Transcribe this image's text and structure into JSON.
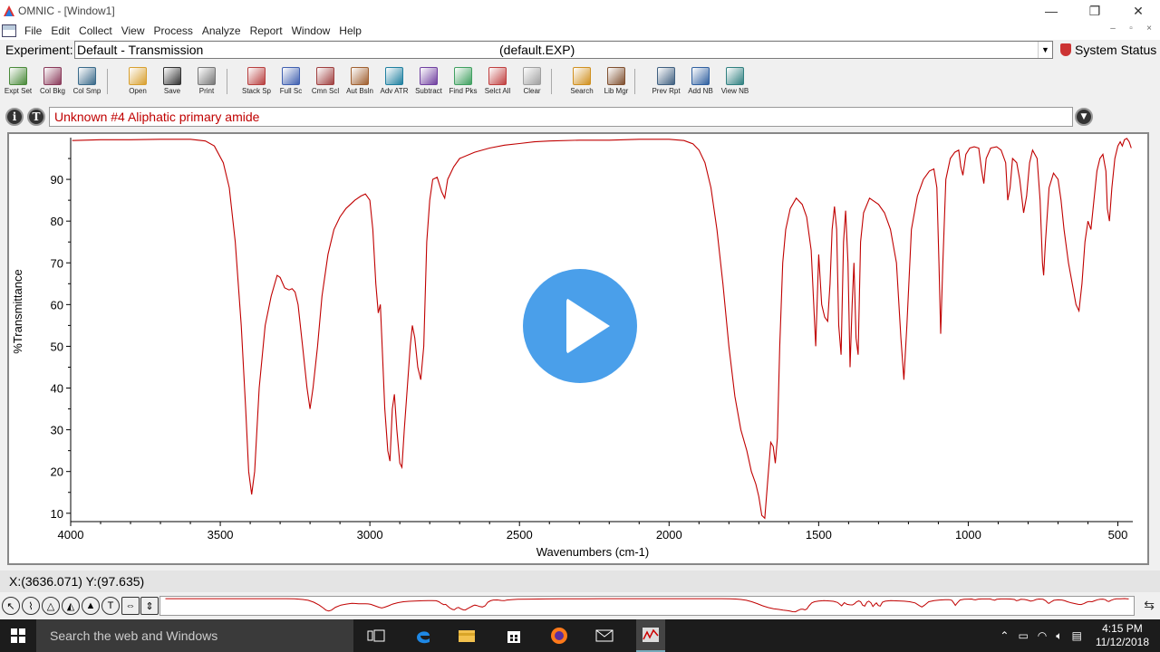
{
  "window": {
    "title": "OMNIC - [Window1]",
    "controls": [
      "—",
      "❐",
      "✕"
    ]
  },
  "menu": {
    "items": [
      "File",
      "Edit",
      "Collect",
      "View",
      "Process",
      "Analyze",
      "Report",
      "Window",
      "Help"
    ]
  },
  "experiment": {
    "label": "Experiment:",
    "value": "Default - Transmission",
    "file": "(default.EXP)",
    "status_label": "System Status"
  },
  "toolbar": {
    "buttons": [
      {
        "label": "Expt Set",
        "icon": "experiment-setup-icon",
        "color": "#4a8a3a"
      },
      {
        "label": "Col Bkg",
        "icon": "collect-background-icon",
        "color": "#8a3a5a"
      },
      {
        "label": "Col Smp",
        "icon": "collect-sample-icon",
        "color": "#3a6a8a"
      },
      {
        "label": "Open",
        "icon": "open-folder-icon",
        "color": "#d8a030"
      },
      {
        "label": "Save",
        "icon": "save-disk-icon",
        "color": "#333333"
      },
      {
        "label": "Print",
        "icon": "printer-icon",
        "color": "#777777"
      },
      {
        "label": "Stack Sp",
        "icon": "stack-spectra-icon",
        "color": "#b84040"
      },
      {
        "label": "Full Sc",
        "icon": "full-scale-icon",
        "color": "#4060b0"
      },
      {
        "label": "Cmn Scl",
        "icon": "common-scale-icon",
        "color": "#a04040"
      },
      {
        "label": "Aut Bsln",
        "icon": "auto-baseline-icon",
        "color": "#a06030"
      },
      {
        "label": "Adv ATR",
        "icon": "advanced-atr-icon",
        "color": "#2080a0"
      },
      {
        "label": "Subtract",
        "icon": "subtract-icon",
        "color": "#7040a0"
      },
      {
        "label": "Find Pks",
        "icon": "find-peaks-icon",
        "color": "#40a060"
      },
      {
        "label": "Selct All",
        "icon": "select-all-icon",
        "color": "#c04040"
      },
      {
        "label": "Clear",
        "icon": "clear-icon",
        "color": "#a0a0a0"
      },
      {
        "label": "Search",
        "icon": "search-magnifier-icon",
        "color": "#d09020"
      },
      {
        "label": "Lib Mgr",
        "icon": "library-manager-icon",
        "color": "#805030"
      },
      {
        "label": "Prev Rpt",
        "icon": "preview-report-icon",
        "color": "#406080"
      },
      {
        "label": "Add NB",
        "icon": "add-notebook-icon",
        "color": "#3060a0"
      },
      {
        "label": "View NB",
        "icon": "view-notebook-icon",
        "color": "#308080"
      }
    ]
  },
  "spectrum_title": "Unknown #4 Aliphatic primary amide",
  "info_buttons": [
    "i",
    "T"
  ],
  "coordinates": "X:(3636.071) Y:(97.635)",
  "accent_colors": {
    "spectrum": "#c00000",
    "play": "#4a9fea"
  },
  "chart_data": {
    "type": "line",
    "title": "",
    "xlabel": "Wavenumbers (cm-1)",
    "ylabel": "%Transmittance",
    "xlim": [
      4000,
      450
    ],
    "ylim": [
      8,
      100
    ],
    "x_reversed": true,
    "grid": false,
    "x_ticks": [
      4000,
      3500,
      3000,
      2500,
      2000,
      1500,
      1000,
      500
    ],
    "y_ticks": [
      10,
      20,
      30,
      40,
      50,
      60,
      70,
      80,
      90
    ],
    "series": [
      {
        "color": "#c00000",
        "points": [
          [
            3995,
            99.3
          ],
          [
            3900,
            99.5
          ],
          [
            3800,
            99.5
          ],
          [
            3700,
            99.6
          ],
          [
            3600,
            99.6
          ],
          [
            3550,
            99.2
          ],
          [
            3520,
            98.0
          ],
          [
            3490,
            94.0
          ],
          [
            3470,
            88.0
          ],
          [
            3450,
            75.0
          ],
          [
            3430,
            55.0
          ],
          [
            3415,
            35.0
          ],
          [
            3405,
            20.0
          ],
          [
            3395,
            14.5
          ],
          [
            3385,
            20.0
          ],
          [
            3370,
            40.0
          ],
          [
            3350,
            55.0
          ],
          [
            3330,
            62.0
          ],
          [
            3310,
            67.0
          ],
          [
            3300,
            66.5
          ],
          [
            3285,
            64.0
          ],
          [
            3270,
            63.5
          ],
          [
            3260,
            63.8
          ],
          [
            3250,
            63.0
          ],
          [
            3240,
            60.0
          ],
          [
            3225,
            50.0
          ],
          [
            3210,
            40.0
          ],
          [
            3200,
            35.0
          ],
          [
            3190,
            40.0
          ],
          [
            3175,
            50.0
          ],
          [
            3160,
            62.0
          ],
          [
            3140,
            72.0
          ],
          [
            3120,
            78.0
          ],
          [
            3100,
            81.0
          ],
          [
            3080,
            83.0
          ],
          [
            3050,
            85.0
          ],
          [
            3030,
            86.0
          ],
          [
            3015,
            86.5
          ],
          [
            3000,
            85.0
          ],
          [
            2990,
            78.0
          ],
          [
            2980,
            65.0
          ],
          [
            2972,
            58.0
          ],
          [
            2965,
            60.0
          ],
          [
            2960,
            52.0
          ],
          [
            2950,
            35.0
          ],
          [
            2940,
            25.0
          ],
          [
            2933,
            22.5
          ],
          [
            2925,
            35.0
          ],
          [
            2918,
            38.5
          ],
          [
            2910,
            30.0
          ],
          [
            2900,
            22.0
          ],
          [
            2893,
            21.0
          ],
          [
            2885,
            30.0
          ],
          [
            2875,
            40.0
          ],
          [
            2865,
            50.0
          ],
          [
            2858,
            55.0
          ],
          [
            2850,
            52.0
          ],
          [
            2840,
            45.0
          ],
          [
            2830,
            42.0
          ],
          [
            2820,
            50.0
          ],
          [
            2810,
            75.0
          ],
          [
            2800,
            85.0
          ],
          [
            2790,
            90.0
          ],
          [
            2775,
            90.5
          ],
          [
            2760,
            87.0
          ],
          [
            2750,
            85.5
          ],
          [
            2740,
            90.0
          ],
          [
            2720,
            93.0
          ],
          [
            2700,
            95.0
          ],
          [
            2650,
            96.5
          ],
          [
            2600,
            97.5
          ],
          [
            2550,
            98.2
          ],
          [
            2500,
            98.6
          ],
          [
            2450,
            99.0
          ],
          [
            2400,
            99.2
          ],
          [
            2300,
            99.4
          ],
          [
            2200,
            99.4
          ],
          [
            2100,
            99.6
          ],
          [
            2000,
            99.6
          ],
          [
            1950,
            99.3
          ],
          [
            1920,
            98.5
          ],
          [
            1900,
            97.0
          ],
          [
            1880,
            94.0
          ],
          [
            1860,
            88.0
          ],
          [
            1840,
            78.0
          ],
          [
            1820,
            65.0
          ],
          [
            1800,
            50.0
          ],
          [
            1780,
            38.0
          ],
          [
            1760,
            30.0
          ],
          [
            1740,
            25.0
          ],
          [
            1725,
            20.0
          ],
          [
            1710,
            17.0
          ],
          [
            1700,
            14.0
          ],
          [
            1690,
            9.5
          ],
          [
            1680,
            8.8
          ],
          [
            1670,
            18.0
          ],
          [
            1660,
            27.0
          ],
          [
            1652,
            26.0
          ],
          [
            1645,
            22.0
          ],
          [
            1638,
            28.0
          ],
          [
            1630,
            50.0
          ],
          [
            1620,
            70.0
          ],
          [
            1610,
            78.0
          ],
          [
            1595,
            83.0
          ],
          [
            1575,
            85.5
          ],
          [
            1555,
            84.0
          ],
          [
            1540,
            81.0
          ],
          [
            1525,
            73.0
          ],
          [
            1510,
            50.0
          ],
          [
            1500,
            72.0
          ],
          [
            1490,
            60.0
          ],
          [
            1480,
            57.0
          ],
          [
            1470,
            56.0
          ],
          [
            1462,
            65.0
          ],
          [
            1455,
            78.0
          ],
          [
            1447,
            83.5
          ],
          [
            1440,
            78.0
          ],
          [
            1433,
            55.0
          ],
          [
            1425,
            48.0
          ],
          [
            1417,
            75.0
          ],
          [
            1410,
            82.5
          ],
          [
            1402,
            70.0
          ],
          [
            1395,
            45.0
          ],
          [
            1388,
            60.0
          ],
          [
            1382,
            70.0
          ],
          [
            1375,
            52.0
          ],
          [
            1368,
            48.0
          ],
          [
            1360,
            75.0
          ],
          [
            1350,
            82.0
          ],
          [
            1330,
            85.5
          ],
          [
            1300,
            84.0
          ],
          [
            1280,
            82.0
          ],
          [
            1260,
            78.0
          ],
          [
            1240,
            70.0
          ],
          [
            1225,
            52.0
          ],
          [
            1215,
            42.0
          ],
          [
            1205,
            55.0
          ],
          [
            1190,
            78.0
          ],
          [
            1170,
            86.0
          ],
          [
            1150,
            90.0
          ],
          [
            1130,
            92.0
          ],
          [
            1115,
            92.5
          ],
          [
            1105,
            88.0
          ],
          [
            1098,
            70.0
          ],
          [
            1092,
            53.0
          ],
          [
            1085,
            70.0
          ],
          [
            1075,
            90.0
          ],
          [
            1060,
            95.0
          ],
          [
            1045,
            96.5
          ],
          [
            1032,
            97.0
          ],
          [
            1025,
            93.0
          ],
          [
            1018,
            91.0
          ],
          [
            1008,
            96.0
          ],
          [
            995,
            97.5
          ],
          [
            980,
            97.8
          ],
          [
            965,
            97.5
          ],
          [
            955,
            92.0
          ],
          [
            948,
            89.0
          ],
          [
            940,
            95.0
          ],
          [
            925,
            97.5
          ],
          [
            905,
            97.8
          ],
          [
            890,
            97.0
          ],
          [
            875,
            94.0
          ],
          [
            868,
            85.0
          ],
          [
            860,
            88.0
          ],
          [
            852,
            95.0
          ],
          [
            838,
            94.0
          ],
          [
            828,
            90.0
          ],
          [
            815,
            82.0
          ],
          [
            805,
            86.0
          ],
          [
            795,
            94.0
          ],
          [
            785,
            97.0
          ],
          [
            770,
            95.0
          ],
          [
            760,
            85.0
          ],
          [
            752,
            70.0
          ],
          [
            748,
            67.0
          ],
          [
            742,
            75.0
          ],
          [
            730,
            88.0
          ],
          [
            715,
            91.5
          ],
          [
            700,
            90.0
          ],
          [
            690,
            85.0
          ],
          [
            680,
            78.0
          ],
          [
            665,
            70.0
          ],
          [
            650,
            64.0
          ],
          [
            640,
            60.0
          ],
          [
            630,
            58.5
          ],
          [
            620,
            65.0
          ],
          [
            610,
            75.0
          ],
          [
            600,
            80.0
          ],
          [
            590,
            78.0
          ],
          [
            580,
            85.0
          ],
          [
            570,
            92.0
          ],
          [
            560,
            95.0
          ],
          [
            550,
            96.0
          ],
          [
            540,
            92.0
          ],
          [
            535,
            83.0
          ],
          [
            528,
            80.0
          ],
          [
            520,
            88.0
          ],
          [
            510,
            95.0
          ],
          [
            500,
            98.0
          ],
          [
            492,
            99.0
          ],
          [
            485,
            98.0
          ],
          [
            478,
            99.5
          ],
          [
            470,
            99.8
          ],
          [
            462,
            99.0
          ],
          [
            455,
            97.5
          ]
        ]
      }
    ]
  }
}
